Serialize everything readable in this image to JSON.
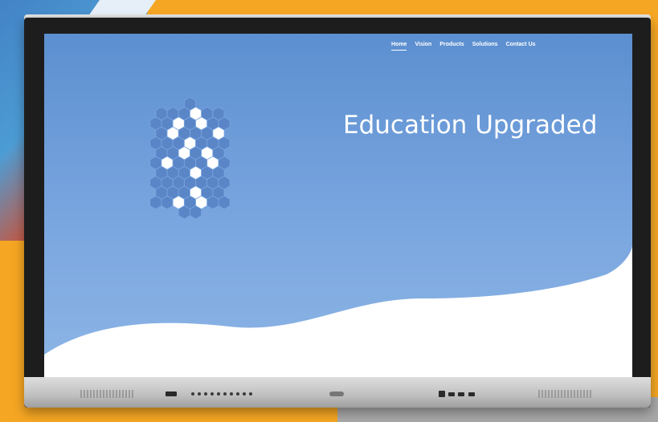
{
  "nav": {
    "items": [
      "Home",
      "Vision",
      "Products",
      "Solutions",
      "Contact Us"
    ],
    "active": "Home"
  },
  "hero": {
    "title": "Education Upgraded"
  },
  "colors": {
    "background": "#f5a623",
    "screen_top": "#5c8fd0",
    "screen_bottom": "#8db6e6",
    "hex_light": "#5a86c8",
    "hex_white": "#ffffff",
    "bezel": "#c8c8c8"
  },
  "icons": {
    "logo": "hexagon-cluster-logo"
  }
}
